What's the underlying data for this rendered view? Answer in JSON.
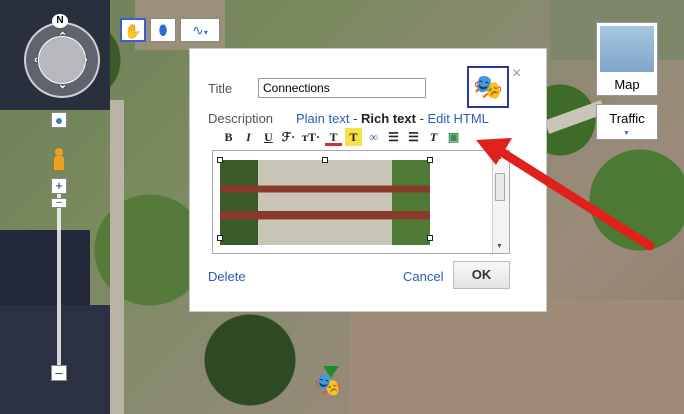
{
  "map_controls": {
    "compass_label": "N",
    "zoom_in_label": "+",
    "zoom_out_label": "–",
    "mid_label": "–"
  },
  "toolbar_top": {
    "hand_icon": "hand-icon",
    "marker_icon": "placemark-icon",
    "line_icon": "line-tool-icon"
  },
  "map_type": {
    "map_label": "Map",
    "traffic_label": "Traffic"
  },
  "bubble": {
    "title_label": "Title",
    "title_value": "Connections",
    "description_label": "Description",
    "mode_plain": "Plain text",
    "mode_sep1": " - ",
    "mode_rich": "Rich text",
    "mode_sep2": " - ",
    "mode_html": "Edit HTML",
    "toolbar": [
      {
        "name": "bold",
        "label": "B"
      },
      {
        "name": "italic",
        "label": "I"
      },
      {
        "name": "underline",
        "label": "U"
      },
      {
        "name": "font",
        "label": "ℱ·"
      },
      {
        "name": "font-size",
        "label": "тT·"
      },
      {
        "name": "text-color",
        "label": "T"
      },
      {
        "name": "highlight",
        "label": "T"
      },
      {
        "name": "link",
        "label": "∞"
      },
      {
        "name": "numbered-list",
        "label": "☰"
      },
      {
        "name": "bulleted-list",
        "label": "☰"
      },
      {
        "name": "remove-format",
        "label": "T"
      },
      {
        "name": "image",
        "label": "▣"
      }
    ],
    "delete_label": "Delete",
    "cancel_label": "Cancel",
    "ok_label": "OK",
    "close_label": "×"
  },
  "accent_colors": {
    "link": "#2a5db0",
    "annotation_arrow": "#e0201a"
  }
}
